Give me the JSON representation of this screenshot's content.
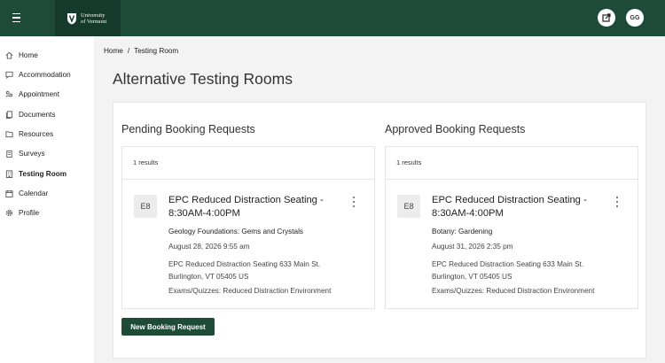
{
  "header": {
    "logo_line1": "University",
    "logo_line2": "of Vermont",
    "avatar_initials": "GG",
    "brand_color": "#1e4a38"
  },
  "sidebar": {
    "items": [
      {
        "label": "Home",
        "icon": "home-icon"
      },
      {
        "label": "Accommodation",
        "icon": "chat-icon"
      },
      {
        "label": "Appointment",
        "icon": "people-icon"
      },
      {
        "label": "Documents",
        "icon": "documents-icon"
      },
      {
        "label": "Resources",
        "icon": "folder-icon"
      },
      {
        "label": "Surveys",
        "icon": "clipboard-icon"
      },
      {
        "label": "Testing Room",
        "icon": "building-icon"
      },
      {
        "label": "Calendar",
        "icon": "calendar-icon"
      },
      {
        "label": "Profile",
        "icon": "gear-icon"
      }
    ],
    "active": "Testing Room"
  },
  "breadcrumb": {
    "home": "Home",
    "separator": "/",
    "current": "Testing Room"
  },
  "page": {
    "title": "Alternative Testing Rooms",
    "new_button": "New Booking Request"
  },
  "pending": {
    "title": "Pending Booking Requests",
    "results": "1 results",
    "booking": {
      "code": "E8",
      "title": "EPC Reduced Distraction Seating - 8:30AM-4:00PM",
      "course": "Geology Foundations: Gems and Crystals",
      "date": "August 28, 2026 9:55 am",
      "address_line1": "EPC Reduced Distraction Seating 633 Main St.",
      "address_line2": "Burlington, VT 05405 US",
      "exam_type": "Exams/Quizzes: Reduced Distraction Environment"
    }
  },
  "approved": {
    "title": "Approved Booking Requests",
    "results": "1 results",
    "booking": {
      "code": "E8",
      "title": "EPC Reduced Distraction Seating - 8:30AM-4:00PM",
      "course": "Botany: Gardening",
      "date": "August 31, 2026 2:35 pm",
      "address_line1": "EPC Reduced Distraction Seating 633 Main St.",
      "address_line2": "Burlington, VT 05405 US",
      "exam_type": "Exams/Quizzes: Reduced Distraction Environment"
    }
  }
}
